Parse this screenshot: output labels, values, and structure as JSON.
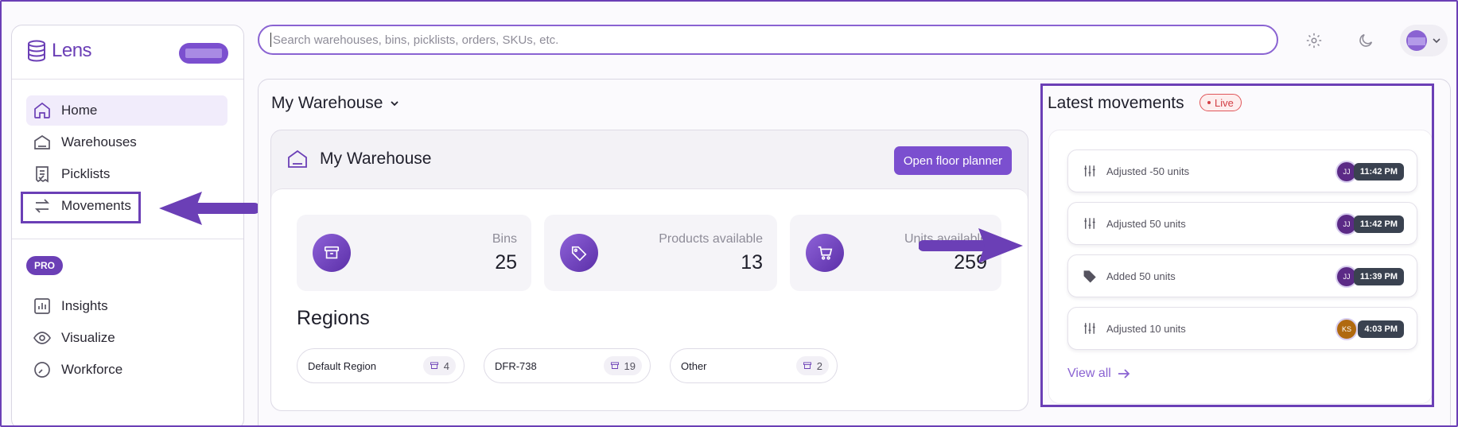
{
  "sidebar": {
    "logo_text": "Lens",
    "items": [
      {
        "label": "Home",
        "icon": "home-icon"
      },
      {
        "label": "Warehouses",
        "icon": "warehouse-icon"
      },
      {
        "label": "Picklists",
        "icon": "picklist-icon"
      },
      {
        "label": "Movements",
        "icon": "movements-icon"
      },
      {
        "label": "Insights",
        "icon": "insights-icon"
      },
      {
        "label": "Visualize",
        "icon": "eye-icon"
      },
      {
        "label": "Workforce",
        "icon": "gauge-icon"
      }
    ],
    "pro_label": "PRO",
    "active_item": "Home"
  },
  "search": {
    "placeholder": "Search warehouses, bins, picklists, orders, SKUs, etc."
  },
  "main": {
    "warehouse_selector": "My Warehouse",
    "warehouse_title": "My Warehouse",
    "open_floor_planner": "Open floor planner",
    "stats": [
      {
        "label": "Bins",
        "value": "25",
        "icon": "archive-icon"
      },
      {
        "label": "Products available",
        "value": "13",
        "icon": "tag-icon"
      },
      {
        "label": "Units available",
        "value": "259",
        "icon": "cart-icon"
      }
    ],
    "regions_heading": "Regions",
    "regions": [
      {
        "name": "Default Region",
        "count": "4"
      },
      {
        "name": "DFR-738",
        "count": "19"
      },
      {
        "name": "Other",
        "count": "2"
      }
    ]
  },
  "movements": {
    "title": "Latest movements",
    "live_label": "Live",
    "items": [
      {
        "text": "Adjusted -50 units",
        "icon": "sliders-icon",
        "user": "JJ",
        "user_color": "#5b2a86",
        "time": "11:42 PM"
      },
      {
        "text": "Adjusted 50 units",
        "icon": "sliders-icon",
        "user": "JJ",
        "user_color": "#5b2a86",
        "time": "11:42 PM"
      },
      {
        "text": "Added 50 units",
        "icon": "tag-icon",
        "user": "JJ",
        "user_color": "#5b2a86",
        "time": "11:39 PM"
      },
      {
        "text": "Adjusted 10 units",
        "icon": "sliders-icon",
        "user": "KS",
        "user_color": "#b0690f",
        "time": "4:03 PM"
      }
    ],
    "view_all": "View all"
  },
  "colors": {
    "accent": "#6b3fb6",
    "button": "#7b4fcf",
    "live": "#d23d43"
  }
}
